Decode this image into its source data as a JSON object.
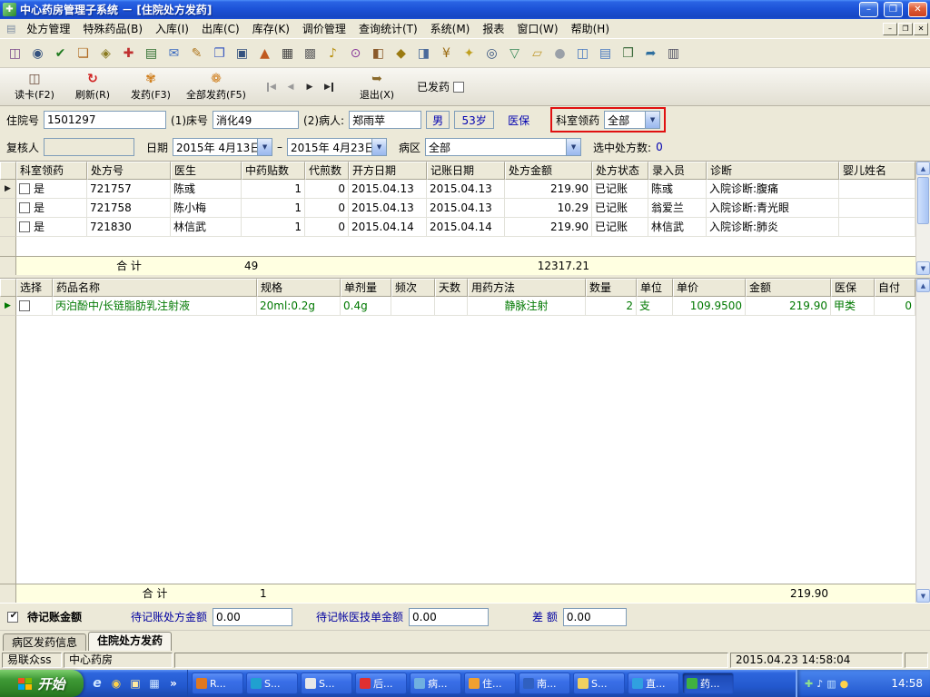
{
  "window": {
    "title": "中心药房管理子系统 － [住院处方发药]",
    "app_icon": "✚",
    "min": "–",
    "restore": "❐",
    "close": "✕"
  },
  "menu": {
    "doc_icon": "▤",
    "win_min": "–",
    "win_restore": "❐",
    "win_close": "✕",
    "items": [
      {
        "label": "处方管理"
      },
      {
        "label": "特殊药品(B)"
      },
      {
        "label": "入库(I)"
      },
      {
        "label": "出库(C)"
      },
      {
        "label": "库存(K)"
      },
      {
        "label": "调价管理"
      },
      {
        "label": "查询统计(T)"
      },
      {
        "label": "系统(M)"
      },
      {
        "label": "报表"
      },
      {
        "label": "窗口(W)"
      },
      {
        "label": "帮助(H)"
      }
    ]
  },
  "toolbar": {
    "icons": [
      {
        "name": "card-reader-icon",
        "glyph": "◫",
        "style": "color:#7a4a8a"
      },
      {
        "name": "binoculars-icon",
        "glyph": "◉",
        "style": "color:#35527f"
      },
      {
        "name": "approve-icon",
        "glyph": "✔",
        "style": "color:#1f7a1f"
      },
      {
        "name": "ledger-icon",
        "glyph": "❏",
        "style": "color:#b06a20"
      },
      {
        "name": "book-search-icon",
        "glyph": "◈",
        "style": "color:#8a7a20"
      },
      {
        "name": "first-aid-icon",
        "glyph": "✚",
        "style": "color:#c03030"
      },
      {
        "name": "rx-form-icon",
        "glyph": "▤",
        "style": "color:#2f6f2f"
      },
      {
        "name": "mail-icon",
        "glyph": "✉",
        "style": "color:#3a6ac0"
      },
      {
        "name": "edit-icon",
        "glyph": "✎",
        "style": "color:#b07820"
      },
      {
        "name": "copy-icon",
        "glyph": "❐",
        "style": "color:#3a5ac0"
      },
      {
        "name": "save-icon",
        "glyph": "▣",
        "style": "color:#35527f"
      },
      {
        "name": "chart-icon",
        "glyph": "▲",
        "style": "color:#c05a20"
      },
      {
        "name": "table-icon",
        "glyph": "▦",
        "style": "color:#444444"
      },
      {
        "name": "keyboard-icon",
        "glyph": "▩",
        "style": "color:#666666"
      },
      {
        "name": "bell-icon",
        "glyph": "♪",
        "style": "color:#b89010"
      },
      {
        "name": "clock-icon",
        "glyph": "⊙",
        "style": "color:#8a3a9a"
      },
      {
        "name": "package-icon",
        "glyph": "◧",
        "style": "color:#8a5a2a"
      },
      {
        "name": "lock-icon",
        "glyph": "◆",
        "style": "color:#9a7a10"
      },
      {
        "name": "cart-icon",
        "glyph": "◨",
        "style": "color:#4a6a9a"
      },
      {
        "name": "money-icon",
        "glyph": "¥",
        "style": "color:#9a6a10"
      },
      {
        "name": "key-icon",
        "glyph": "✦",
        "style": "color:#c0a020"
      },
      {
        "name": "zoom-icon",
        "glyph": "◎",
        "style": "color:#35527f"
      },
      {
        "name": "filter-icon",
        "glyph": "▽",
        "style": "color:#3a8a5a"
      },
      {
        "name": "folder-icon",
        "glyph": "▱",
        "style": "color:#c09a30"
      },
      {
        "name": "globe-icon",
        "glyph": "●",
        "style": "color:#9aa0a8"
      },
      {
        "name": "columns-icon",
        "glyph": "◫",
        "style": "color:#4a7ac0"
      },
      {
        "name": "layers-icon",
        "glyph": "▤",
        "style": "color:#4a7ac0"
      },
      {
        "name": "window-icon",
        "glyph": "❒",
        "style": "color:#3a6a3a"
      },
      {
        "name": "send-icon",
        "glyph": "➦",
        "style": "color:#2f6f9f"
      },
      {
        "name": "printer-icon",
        "glyph": "▥",
        "style": "color:#555566"
      }
    ]
  },
  "actions": {
    "read_card": "读卡(F2)",
    "read_card_icon": "◫",
    "refresh": "刷新(R)",
    "refresh_icon": "↻",
    "dispense": "发药(F3)",
    "dispense_icon": "✾",
    "dispense_all": "全部发药(F5)",
    "dispense_all_icon": "❁",
    "exit": "退出(X)",
    "exit_icon": "➥",
    "dispensed": "已发药",
    "nav_first": "◀",
    "nav_prev": "◀",
    "nav_next": "▶",
    "nav_last": "▶"
  },
  "patient": {
    "admission_label": "住院号",
    "admission_no": "1501297",
    "bed_label": "(1)床号",
    "bed": "消化49",
    "patient_label": "(2)病人:",
    "patient_name": "郑雨苹",
    "gender": "男",
    "age": "53岁",
    "insurance": "医保",
    "dept_label": "科室领药",
    "dept_value": "全部"
  },
  "filter": {
    "reviewer_label": "复核人",
    "reviewer": "",
    "date_label": "日期",
    "date_from": "2015年 4月13日",
    "date_sep": "–",
    "date_to": "2015年 4月23日",
    "ward_label": "病区",
    "ward": "全部",
    "selected_label": "选中处方数:",
    "selected_count": "0"
  },
  "rx_table": {
    "headers": [
      "科室领药",
      "处方号",
      "医生",
      "中药贴数",
      "代煎数",
      "开方日期",
      "记账日期",
      "处方金额",
      "处方状态",
      "录入员",
      "诊断",
      "婴儿姓名"
    ],
    "rows": [
      {
        "dept": "是",
        "rx_no": "721757",
        "doctor": "陈彧",
        "herbs": "1",
        "decoct": "0",
        "open_date": "2015.04.13",
        "bill_date": "2015.04.13",
        "amount": "219.90",
        "status": "已记账",
        "operator": "陈彧",
        "diagnosis": "入院诊断:腹痛",
        "baby": ""
      },
      {
        "dept": "是",
        "rx_no": "721758",
        "doctor": "陈小梅",
        "herbs": "1",
        "decoct": "0",
        "open_date": "2015.04.13",
        "bill_date": "2015.04.13",
        "amount": "10.29",
        "status": "已记账",
        "operator": "翁爱兰",
        "diagnosis": "入院诊断:青光眼",
        "baby": ""
      },
      {
        "dept": "是",
        "rx_no": "721830",
        "doctor": "林信武",
        "herbs": "1",
        "decoct": "0",
        "open_date": "2015.04.14",
        "bill_date": "2015.04.14",
        "amount": "219.90",
        "status": "已记账",
        "operator": "林信武",
        "diagnosis": "入院诊断:肺炎",
        "baby": ""
      }
    ],
    "sum": {
      "label": "合  计",
      "herbs": "49",
      "amount": "12317.21"
    }
  },
  "drug_table": {
    "headers": [
      "选择",
      "药品名称",
      "规格",
      "单剂量",
      "频次",
      "天数",
      "用药方法",
      "数量",
      "单位",
      "单价",
      "金额",
      "医保",
      "自付"
    ],
    "row": {
      "name": "丙泊酚中/长链脂肪乳注射液",
      "spec": "20ml:0.2g",
      "dose": "0.4g",
      "freq": "",
      "days": "",
      "usage": "静脉注射",
      "qty": "2",
      "unit": "支",
      "price": "109.9500",
      "amount": "219.90",
      "insurance": "甲类",
      "self_pay": "0"
    },
    "sum": {
      "label": "合  计",
      "count": "1",
      "amount": "219.90"
    }
  },
  "pending": {
    "checkbox_label": "待记账金额",
    "rx_amount_label": "待记账处方金额",
    "rx_amount": "0.00",
    "tech_amount_label": "待记帐医技单金额",
    "tech_amount": "0.00",
    "diff_label": "差 额",
    "diff": "0.00"
  },
  "tabs": {
    "tab1": "病区发药信息",
    "tab2": "住院处方发药"
  },
  "status": {
    "user": "易联众ss",
    "dept": "中心药房",
    "datetime": "2015.04.23 14:58:04"
  },
  "taskbar": {
    "start": "开始",
    "quick": [
      {
        "name": "ie-icon",
        "glyph": "e",
        "style": "color:#cfe6ff;font-style:italic;font-weight:bold;font-size:14px"
      },
      {
        "name": "media-player-icon",
        "glyph": "◉",
        "style": "color:#ffd24a"
      },
      {
        "name": "folder-icon",
        "glyph": "▣",
        "style": "color:#ffe9a0"
      },
      {
        "name": "show-desktop-icon",
        "glyph": "▦",
        "style": "color:#cfe6ff"
      },
      {
        "name": "expand-icon",
        "glyph": "»",
        "style": "color:#ffffff;font-weight:bold"
      }
    ],
    "tasks": [
      {
        "label": "R...",
        "icon_style": "background:#e07820"
      },
      {
        "label": "S...",
        "icon_style": "background:#20a0d0"
      },
      {
        "label": "S...",
        "icon_style": "background:#e8e8e8"
      },
      {
        "label": "后...",
        "icon_style": "background:#e03030"
      },
      {
        "label": "病...",
        "icon_style": "background:#70b0e0"
      },
      {
        "label": "住...",
        "icon_style": "background:#f0a030"
      },
      {
        "label": "南...",
        "icon_style": "background:#3060c0"
      },
      {
        "label": "S...",
        "icon_style": "background:#f0d060"
      },
      {
        "label": "直...",
        "icon_style": "background:#30a0e0"
      },
      {
        "label": "药...",
        "icon_style": "background:#40b040",
        "style": "background:linear-gradient(180deg,#1c49b4,#2a5cd0);box-shadow:inset 1px 1px 2px rgba(0,0,0,0.45)"
      }
    ],
    "tray": [
      {
        "name": "security-icon",
        "glyph": "✚",
        "style": "color:#8fe08f"
      },
      {
        "name": "volume-icon",
        "glyph": "♪",
        "style": "color:#eaf2ff"
      },
      {
        "name": "network-icon",
        "glyph": "▥",
        "style": "color:#bfe0ff"
      },
      {
        "name": "message-icon",
        "glyph": "●",
        "style": "color:#ffd24a"
      }
    ],
    "time": "14:58"
  }
}
